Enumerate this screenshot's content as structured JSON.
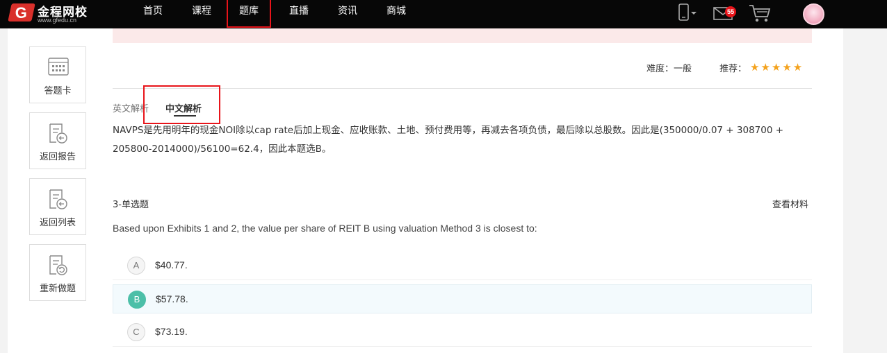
{
  "header": {
    "logo_name": "金程网校",
    "logo_url": "www.gfedu.cn",
    "logo_letter": "G",
    "nav": [
      {
        "label": "首页"
      },
      {
        "label": "课程"
      },
      {
        "label": "题库"
      },
      {
        "label": "直播"
      },
      {
        "label": "资讯"
      },
      {
        "label": "商城"
      }
    ],
    "active_nav": "题库",
    "mail_badge": "55"
  },
  "sidebar": {
    "items": [
      {
        "label": "答题卡",
        "icon": "answer-card-icon"
      },
      {
        "label": "返回报告",
        "icon": "return-report-icon"
      },
      {
        "label": "返回列表",
        "icon": "return-list-icon"
      },
      {
        "label": "重新做题",
        "icon": "redo-icon"
      }
    ]
  },
  "question_meta": {
    "difficulty_label": "难度：一般",
    "recommend_label": "推荐：",
    "stars": "★★★★★",
    "rating": 5
  },
  "analysis": {
    "tabs": [
      {
        "label": "英文解析"
      },
      {
        "label": "中文解析"
      }
    ],
    "active_tab": "中文解析",
    "text": "NAVPS是先用明年的现金NOI除以cap rate后加上现金、应收账款、土地、预付费用等，再减去各项负债，最后除以总股数。因此是(350000/0.07 + 308700 + 205800-2014000)/56100=62.4，因此本题选B。"
  },
  "next_question": {
    "type_label": "3-单选题",
    "view_material": "查看材料",
    "text": "Based upon Exhibits 1 and 2, the value per share of REIT B using valuation Method 3 is closest to:",
    "options": [
      {
        "letter": "A",
        "text": "$40.77."
      },
      {
        "letter": "B",
        "text": "$57.78."
      },
      {
        "letter": "C",
        "text": "$73.19."
      }
    ],
    "selected": "B"
  },
  "colors": {
    "topbar": "#070707",
    "highlight": "#e8141a",
    "selected_option": "#4cbfa8",
    "star": "#f4a21d",
    "logo": "#d9302b"
  }
}
